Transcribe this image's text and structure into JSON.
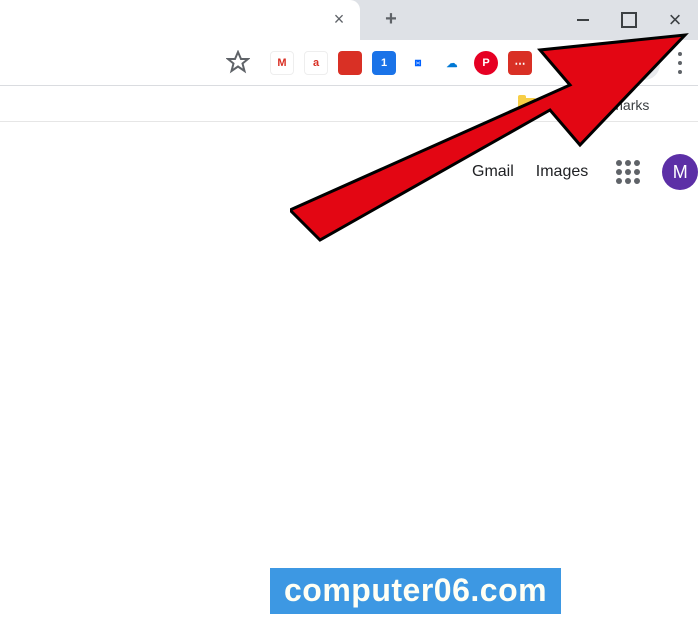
{
  "window_controls": {
    "minimize_glyph": "–",
    "maximize_glyph": "",
    "close_glyph": "×"
  },
  "tabs": {
    "active_tab_title": "",
    "close_tab_glyph": "×",
    "new_tab_tooltip": "+"
  },
  "toolbar": {
    "extensions": [
      {
        "name": "mail-icon",
        "bg": "#ffffff",
        "fg": "#d93025",
        "glyph": "M"
      },
      {
        "name": "a2-ext-icon",
        "bg": "#ffffff",
        "fg": "#d93025",
        "glyph": "a"
      },
      {
        "name": "square-ext-icon",
        "bg": "#d93025",
        "fg": "#ffffff",
        "glyph": ""
      },
      {
        "name": "badge-ext-icon",
        "bg": "#1a73e8",
        "fg": "#ffffff",
        "glyph": "1"
      },
      {
        "name": "dropbox-icon",
        "bg": "#ffffff",
        "fg": "#0061ff",
        "glyph": "⧈"
      },
      {
        "name": "cloud-ext-icon",
        "bg": "#ffffff",
        "fg": "#0078d4",
        "glyph": "☁"
      },
      {
        "name": "pinterest-icon",
        "bg": "#e60023",
        "fg": "#ffffff",
        "glyph": "P"
      },
      {
        "name": "dots-ext-icon",
        "bg": "#d93025",
        "fg": "#ffffff",
        "glyph": "⋯"
      }
    ],
    "star_tooltip": "Bookmark this page",
    "profile_tooltip": "Profile",
    "menu_tooltip": "Customize and control Google Chrome"
  },
  "bookmarks": {
    "other_label": "Other bookmarks"
  },
  "page": {
    "gmail_label": "Gmail",
    "images_label": "Images",
    "apps_tooltip": "Google apps",
    "avatar_letter": "M",
    "avatar_bg": "#5c2fa6"
  },
  "overlay": {
    "arrow_color": "#e30613",
    "arrow_stroke": "#000000"
  },
  "watermark": {
    "text": "computer06.com",
    "bg": "#3d98e3",
    "fg": "#fffff4"
  }
}
